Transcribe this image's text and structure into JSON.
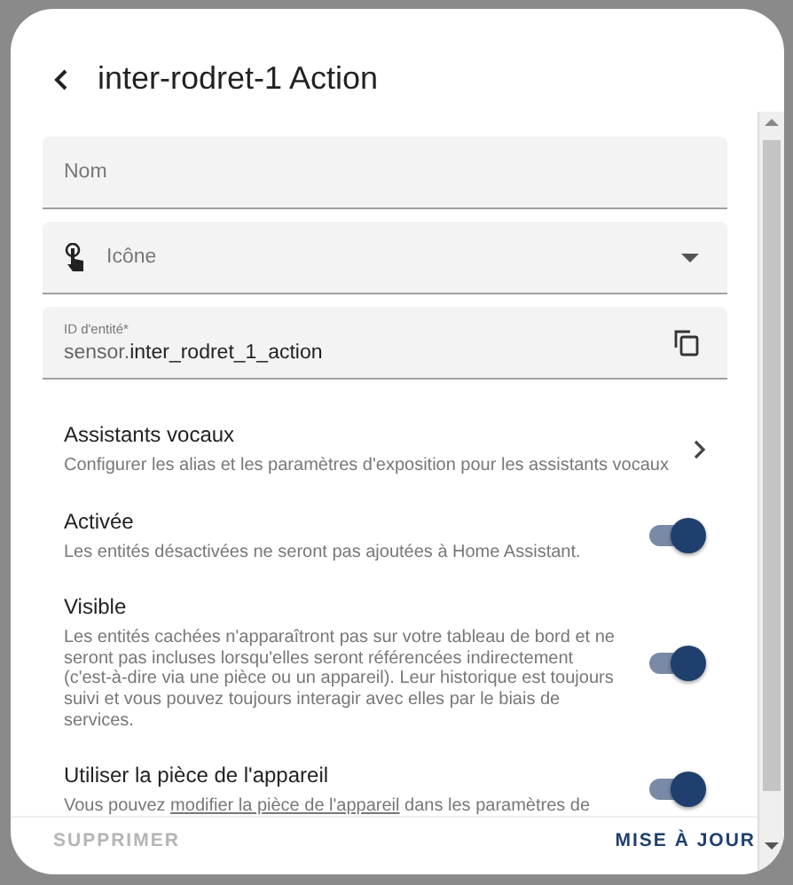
{
  "dialog": {
    "title": "inter-rodret-1 Action"
  },
  "fields": [
    {
      "kind": "text",
      "placeholder": "Nom"
    },
    {
      "kind": "select",
      "placeholder": "Icône"
    },
    {
      "kind": "id",
      "label": "ID d'entité*",
      "prefix": "sensor.",
      "value": "inter_rodret_1_action"
    }
  ],
  "rows": [
    {
      "kind": "link",
      "title": "Assistants vocaux",
      "description": "Configurer les alias et les paramètres d'exposition pour les assistants vocaux"
    },
    {
      "kind": "toggle",
      "title": "Activée",
      "description": "Les entités désactivées ne seront pas ajoutées à Home Assistant.",
      "on": true
    },
    {
      "kind": "toggle",
      "title": "Visible",
      "description": "Les entités cachées n'apparaîtront pas sur votre tableau de bord et ne seront pas incluses lorsqu'elles seront référencées indirectement (c'est-à-dire via une pièce ou un appareil). Leur historique est toujours suivi et vous pouvez toujours interagir avec elles par le biais de services.",
      "on": true
    },
    {
      "kind": "toggle",
      "title": "Utiliser la pièce de l'appareil",
      "description": "Vous pouvez",
      "link": "modifier la pièce de l'appareil",
      "description_after": "dans les paramètres de",
      "on": true
    }
  ],
  "buttons": [
    {
      "label": "SUPPRIMER",
      "disabled": true
    },
    {
      "label": "MISE À JOUR",
      "disabled": false
    }
  ]
}
